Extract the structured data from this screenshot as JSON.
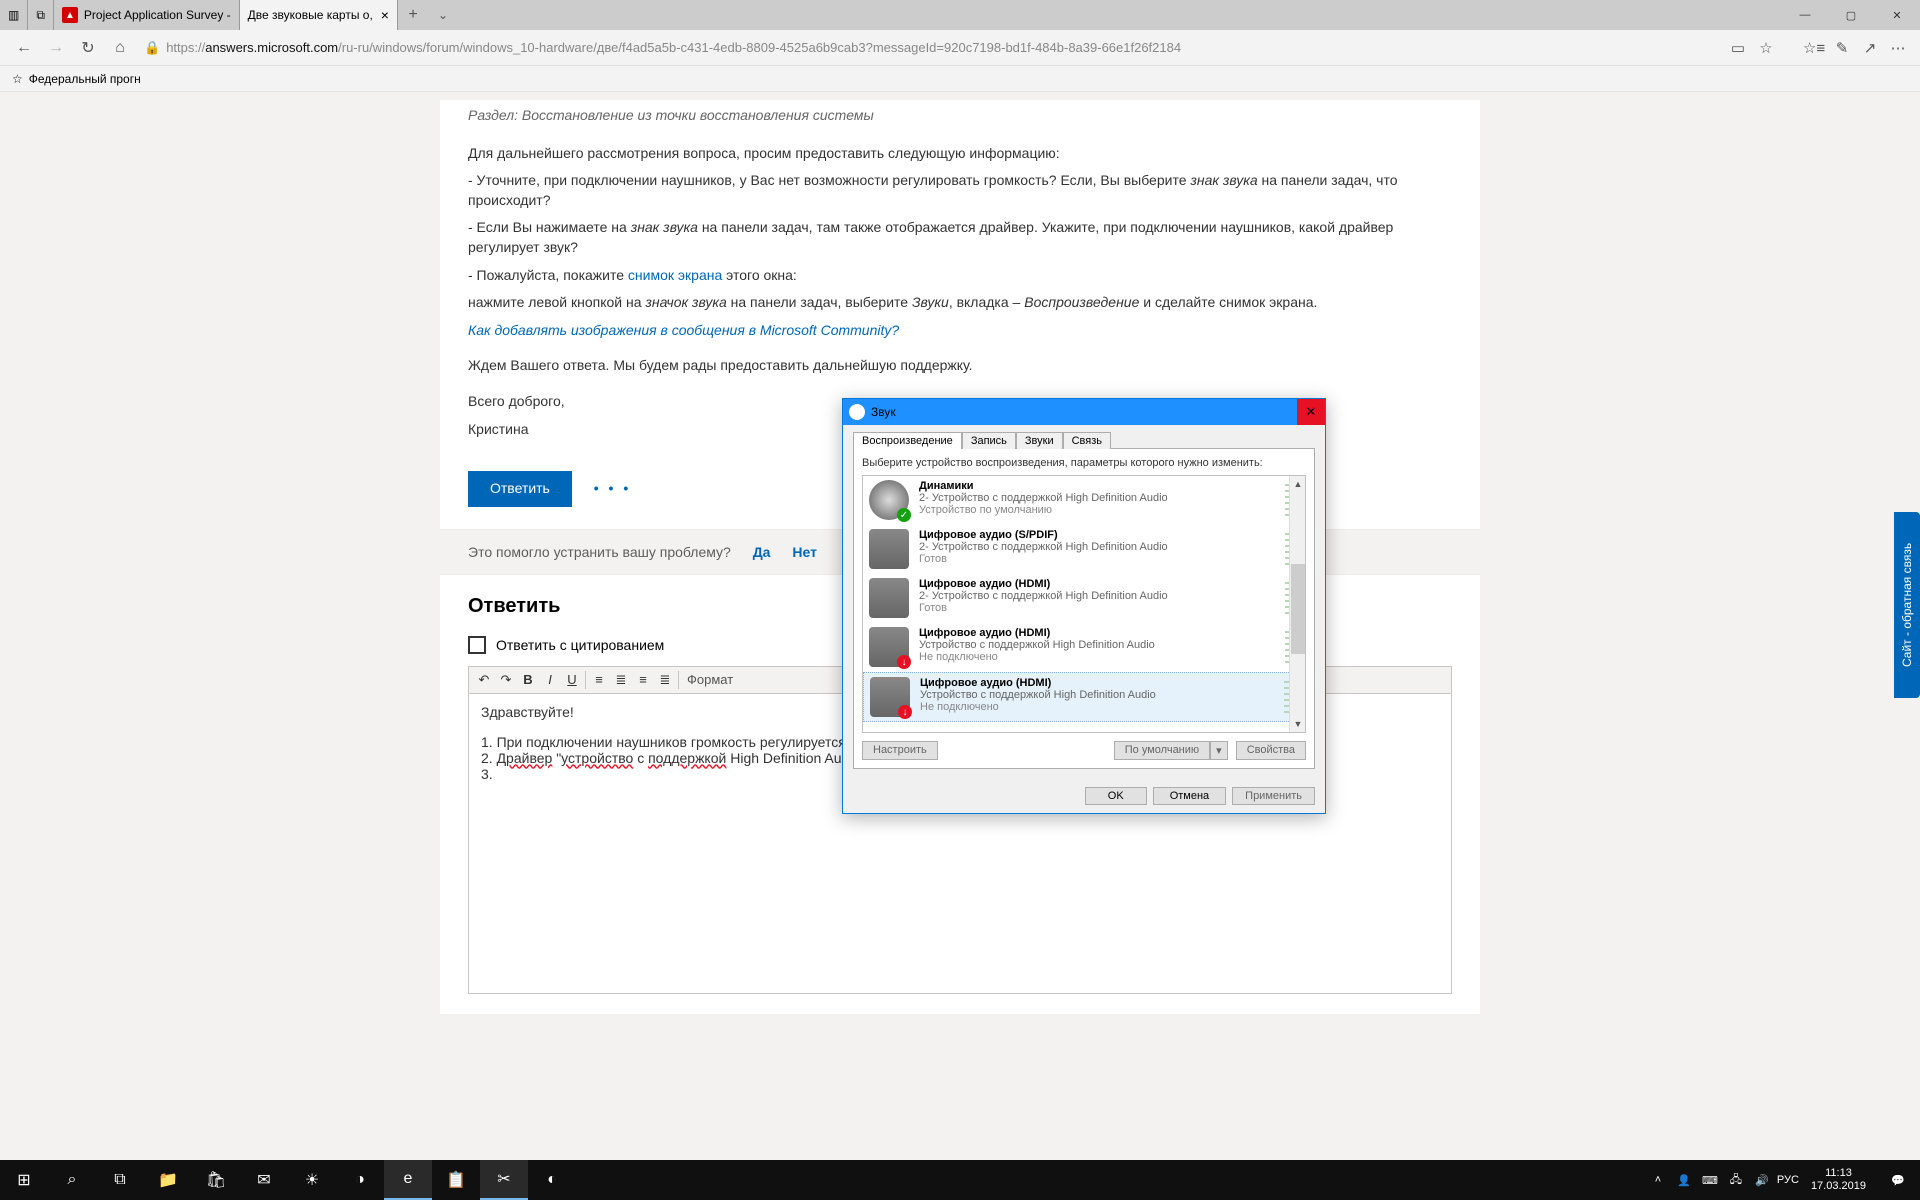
{
  "win": {
    "min": "—",
    "max": "▢",
    "close": "✕"
  },
  "tabs": [
    {
      "title": "Project Application Survey -",
      "icon": "avira"
    },
    {
      "title": "Две звуковые карты о,",
      "icon": "none",
      "active": true
    }
  ],
  "nav": {
    "url_proto": "https://",
    "url_host": "answers.microsoft.com",
    "url_path": "/ru-ru/windows/forum/windows_10-hardware/две/f4ad5a5b-c431-4edb-8809-4525a6b9cab3?messageId=920c7198-bd1f-484b-8a39-66e1f26f2184"
  },
  "fav": "Федеральный прогн",
  "post": {
    "section": "Раздел: Восстановление из точки восстановления системы",
    "intro": "Для дальнейшего рассмотрения вопроса, просим предоставить следующую информацию:",
    "li1a": "- Уточните, при подключении наушников, у Вас нет возможности регулировать громкость? Если, Вы выберите ",
    "li1b": "знак звука",
    "li1c": " на панели задач, что происходит?",
    "li2a": "- Если Вы нажимаете на ",
    "li2b": "знак звука",
    "li2c": " на панели задач, там также отображается драйвер. Укажите, при подключении наушников, какой драйвер регулирует звук?",
    "li3a": "- Пожалуйста, покажите ",
    "li3link": "снимок экрана",
    "li3b": " этого окна:",
    "li4a": "нажмите левой кнопкой на ",
    "li4b": "значок звука",
    "li4c": " на панели задач, выберите ",
    "li4d": "Звуки",
    "li4e": ", вкладка – ",
    "li4f": "Воспроизведение",
    "li4g": " и сделайте снимок экрана.",
    "howto": "Как добавлять изображения в сообщения в Microsoft Community?",
    "wait": "Ждем Вашего ответа. Мы будем рады предоставить дальнейшую поддержку.",
    "bye": "Всего доброго,",
    "name": "Кристина",
    "reply_btn": "Ответить",
    "dots": "• • •"
  },
  "helpbar": {
    "q": "Это помогло устранить вашу проблему?",
    "yes": "Да",
    "no": "Нет"
  },
  "reply": {
    "heading": "Ответить",
    "quote_chk": "Ответить с цитированием",
    "format_label": "Формат",
    "body_greet": "Здравствуйте!",
    "body_l1": "1. При подключении наушников громкость регулируется тем же ползунком, что и колонки",
    "body_l2_a": "2. ",
    "body_l2_b": "Драйвер",
    "body_l2_c": " \"",
    "body_l2_d": "устройство",
    "body_l2_e": " с ",
    "body_l2_f": "поддержкой",
    "body_l2_g": " High Definition Audio\".",
    "body_l3": "3. "
  },
  "sound": {
    "title": "Звук",
    "tabs": [
      "Воспроизведение",
      "Запись",
      "Звуки",
      "Связь"
    ],
    "hint": "Выберите устройство воспроизведения, параметры которого нужно изменить:",
    "devices": [
      {
        "name": "Динамики",
        "desc": "2- Устройство с поддержкой High Definition Audio",
        "status": "Устройство по умолчанию",
        "icon": "speaker",
        "badge": "ok"
      },
      {
        "name": "Цифровое аудио (S/PDIF)",
        "desc": "2- Устройство с поддержкой High Definition Audio",
        "status": "Готов",
        "icon": "box"
      },
      {
        "name": "Цифровое аудио (HDMI)",
        "desc": "2- Устройство с поддержкой High Definition Audio",
        "status": "Готов",
        "icon": "monitor"
      },
      {
        "name": "Цифровое аудио (HDMI)",
        "desc": "Устройство с поддержкой High Definition Audio",
        "status": "Не подключено",
        "icon": "monitor",
        "badge": "err"
      },
      {
        "name": "Цифровое аудио (HDMI)",
        "desc": "Устройство с поддержкой High Definition Audio",
        "status": "Не подключено",
        "icon": "monitor",
        "badge": "err",
        "selected": true
      }
    ],
    "btn_cfg": "Настроить",
    "btn_def": "По умолчанию",
    "btn_prop": "Свойства",
    "btn_ok": "OK",
    "btn_cancel": "Отмена",
    "btn_apply": "Применить"
  },
  "feedback": "Сайт - обратная связь",
  "clock": {
    "time": "11:13",
    "date": "17.03.2019"
  }
}
